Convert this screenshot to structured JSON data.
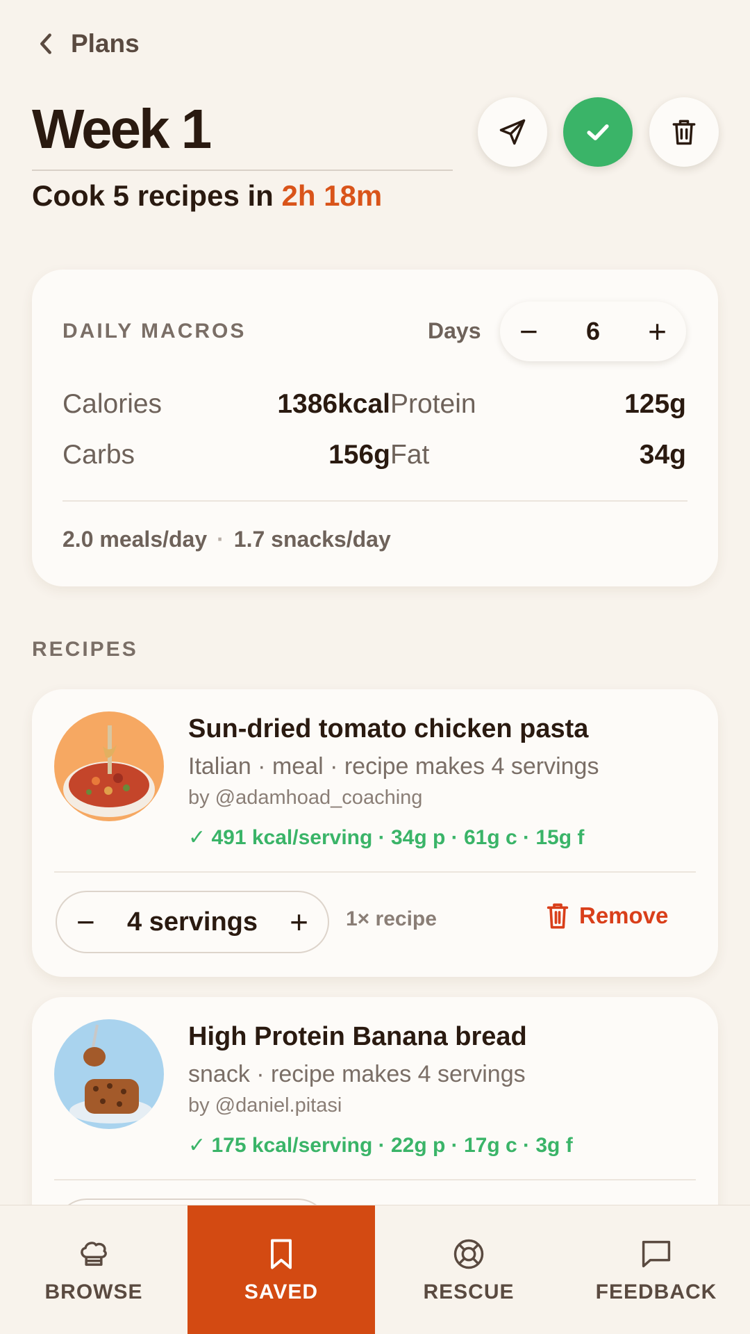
{
  "header": {
    "back_label": "Plans",
    "title": "Week 1",
    "subtitle_prefix": "Cook 5 recipes in ",
    "subtitle_time": "2h 18m"
  },
  "macros": {
    "heading": "DAILY MACROS",
    "days_label": "Days",
    "days_value": "6",
    "items": [
      {
        "label": "Calories",
        "value": "1386kcal"
      },
      {
        "label": "Protein",
        "value": "125g"
      },
      {
        "label": "Carbs",
        "value": "156g"
      },
      {
        "label": "Fat",
        "value": "34g"
      }
    ],
    "meals_per_day": "2.0 meals/day",
    "snacks_per_day": "1.7 snacks/day"
  },
  "recipes_heading": "RECIPES",
  "recipes": [
    {
      "name": "Sun-dried tomato chicken pasta",
      "meta": "Italian · meal · recipe makes 4 servings",
      "author": "by @adamhoad_coaching",
      "nutrition": "✓ 491 kcal/serving · 34g p · 61g c · 15g f",
      "servings": "4 servings",
      "multiplier": "1× recipe",
      "remove_label": "Remove"
    },
    {
      "name": "High Protein Banana bread",
      "meta": "snack · recipe makes 4 servings",
      "author": "by @daniel.pitasi",
      "nutrition": "✓ 175 kcal/serving · 22g p · 17g c · 3g f"
    }
  ],
  "tabs": [
    {
      "label": "BROWSE",
      "icon": "chef-hat-icon"
    },
    {
      "label": "SAVED",
      "icon": "bookmark-icon",
      "active": true
    },
    {
      "label": "RESCUE",
      "icon": "lifebuoy-icon"
    },
    {
      "label": "FEEDBACK",
      "icon": "message-icon"
    }
  ],
  "colors": {
    "accent": "#d34a12",
    "success": "#3ab468",
    "danger": "#d93f1a",
    "background": "#f8f3ec"
  }
}
